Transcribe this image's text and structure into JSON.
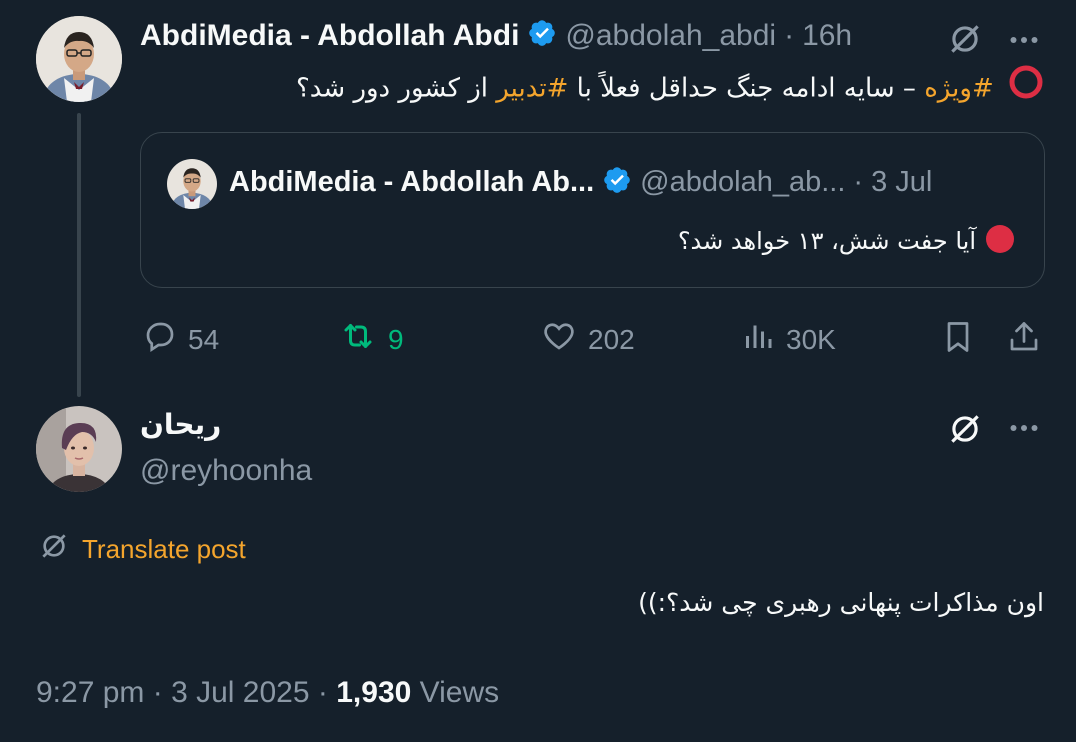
{
  "main_tweet": {
    "name": "AbdiMedia - Abdollah Abdi",
    "handle": "@abdolah_abdi",
    "separator": "·",
    "time": "16h",
    "text_hashtag1": "#ویژه",
    "text_middle": " – سایه ادامه جنگ حداقل فعلاً با ",
    "text_hashtag2": "#تدبیر",
    "text_end": " از کشور دور شد؟"
  },
  "quoted_tweet": {
    "name": "AbdiMedia - Abdollah Ab...",
    "handle": "@abdolah_ab...",
    "separator": "·",
    "time": "3 Jul",
    "text": "آیا جفت شش، ۱۳ خواهد شد؟"
  },
  "actions": {
    "replies": "54",
    "retweets": "9",
    "likes": "202",
    "views": "30K"
  },
  "reply_tweet": {
    "name": "ریحان",
    "handle": "@reyhoonha",
    "translate_label": "Translate post",
    "text": "اون مذاکرات پنهانی رهبری چی شد؟:))",
    "time": "9:27 pm",
    "date": "3 Jul 2025",
    "separator": "·",
    "views_count": "1,930",
    "views_label": "Views"
  },
  "icons": {
    "verified": "verified-badge-icon",
    "translate": "translate-icon",
    "more": "more-icon",
    "reply": "reply-icon",
    "retweet": "retweet-icon",
    "like": "like-icon",
    "views": "views-icon",
    "bookmark": "bookmark-icon",
    "share": "share-icon"
  },
  "colors": {
    "background": "#15202b",
    "accent_hashtag": "#f4a52d",
    "verified": "#1d9bf0",
    "retweet_green": "#00ba7c",
    "muted": "#8b98a5"
  }
}
